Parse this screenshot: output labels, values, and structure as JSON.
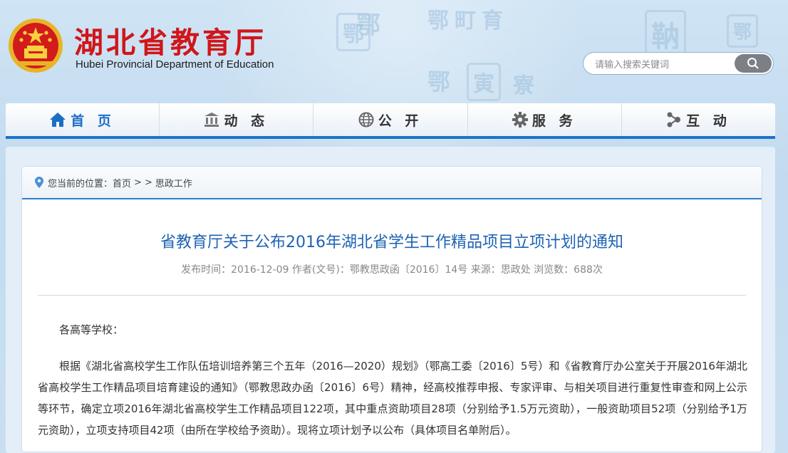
{
  "header": {
    "title_cn": "湖北省教育厅",
    "title_en": "Hubei Provincial Department of Education"
  },
  "search": {
    "placeholder": "请输入搜索关键词"
  },
  "nav": [
    {
      "label": "首 页",
      "icon": "home-icon",
      "active": true
    },
    {
      "label": "动 态",
      "icon": "building-icon",
      "active": false
    },
    {
      "label": "公 开",
      "icon": "globe-icon",
      "active": false
    },
    {
      "label": "服 务",
      "icon": "gear-icon",
      "active": false
    },
    {
      "label": "互 动",
      "icon": "share-icon",
      "active": false
    }
  ],
  "breadcrumb": {
    "prefix": "您当前的位置：",
    "home": "首页",
    "sep1": ">",
    "sep2": ">",
    "current": "思政工作"
  },
  "article": {
    "title": "省教育厅关于公布2016年湖北省学生工作精品项目立项计划的通知",
    "meta": "发布时间：2016-12-09 作者(文号)：鄂教思政函〔2016〕14号 来源：思政处 浏览数：688次",
    "salutation": "各高等学校：",
    "body": "根据《湖北省高校学生工作队伍培训培养第三个五年（2016—2020）规划》（鄂高工委〔2016〕5号）和《省教育厅办公室关于开展2016年湖北省高校学生工作精品项目培育建设的通知》（鄂教思政办函〔2016〕6号）精神，经高校推荐申报、专家评审、与相关项目进行重复性审查和网上公示等环节，确定立项2016年湖北省高校学生工作精品项目122项，其中重点资助项目28项（分别给予1.5万元资助），一般资助项目52项（分别给予1万元资助），立项支持项目42项（由所在学校给予资助）。现将立项计划予以公布（具体项目名单附后）。"
  },
  "colors": {
    "brand_red": "#d0161b",
    "nav_accent": "#1b73c8",
    "title_blue": "#1e63b3"
  }
}
